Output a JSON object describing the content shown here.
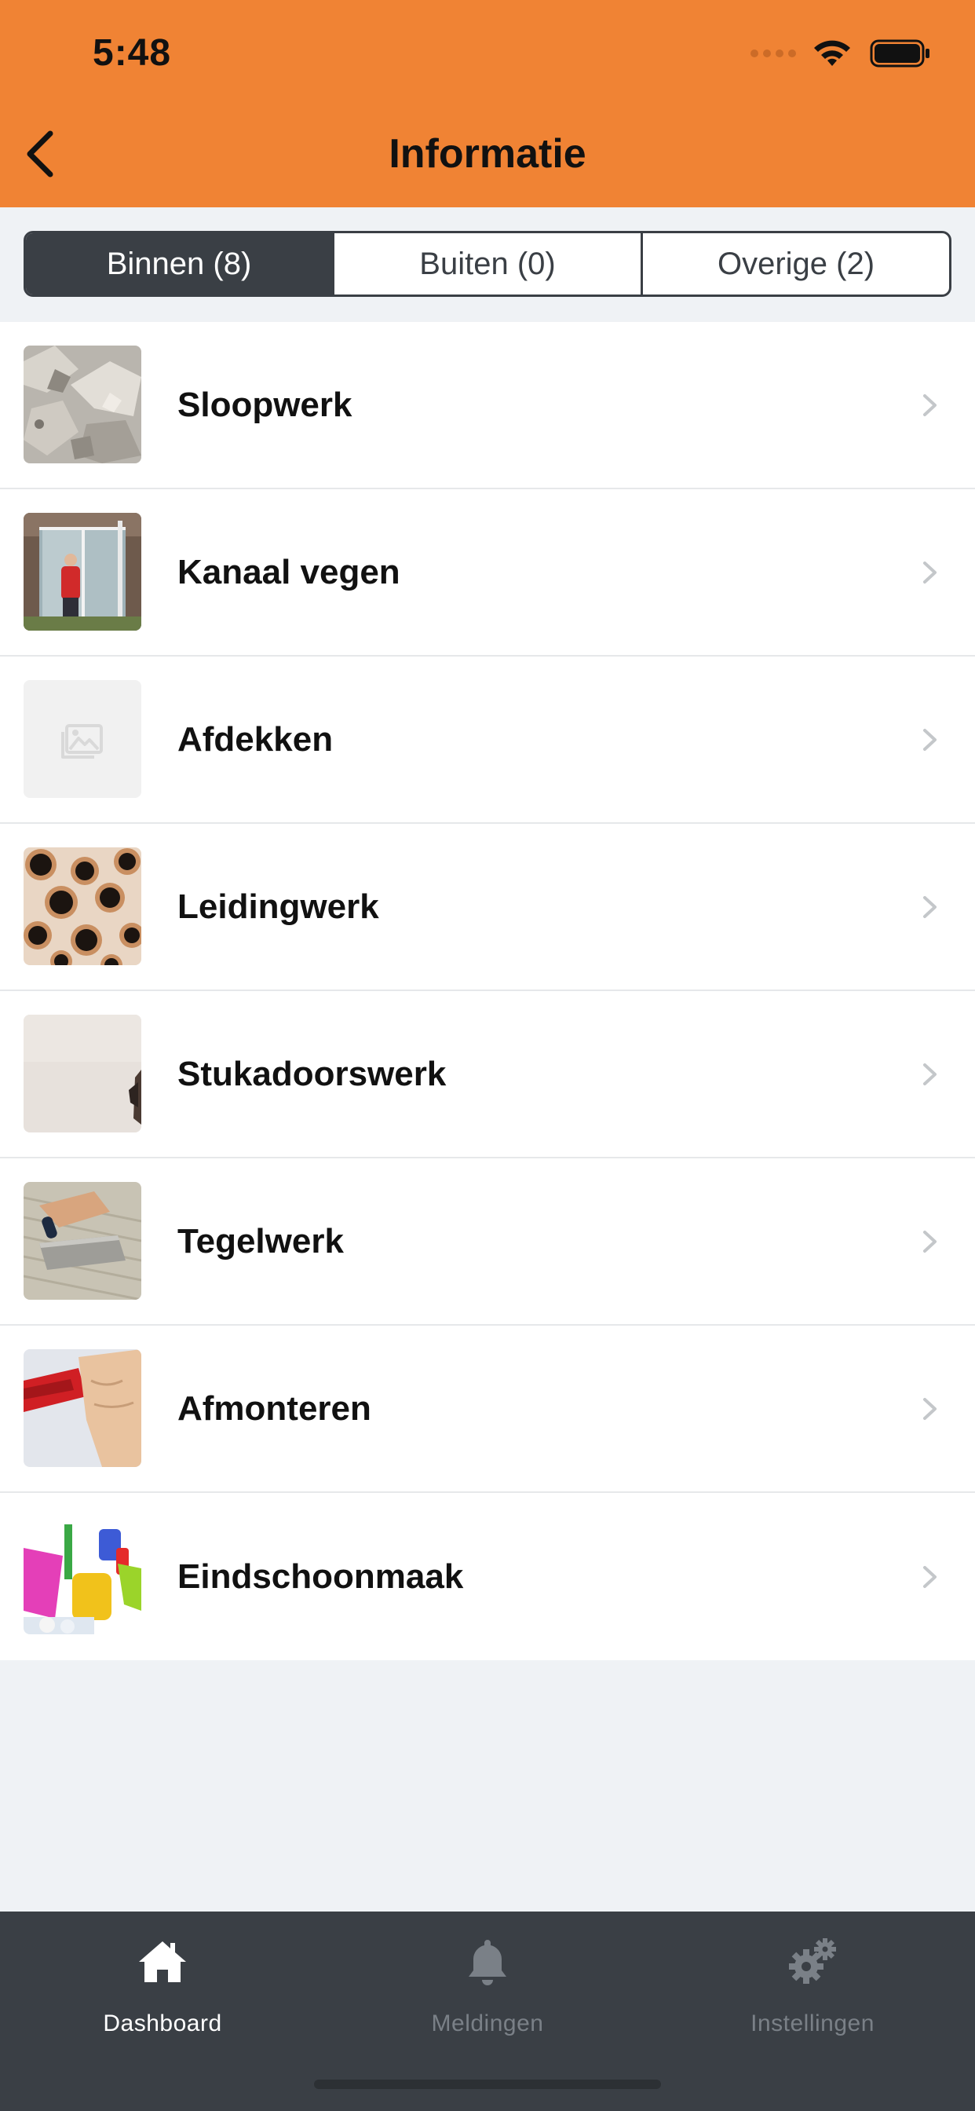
{
  "status_bar": {
    "time": "5:48"
  },
  "header": {
    "title": "Informatie",
    "bg_color": "#f08334"
  },
  "segments": [
    {
      "label": "Binnen (8)",
      "active": true
    },
    {
      "label": "Buiten (0)",
      "active": false
    },
    {
      "label": "Overige (2)",
      "active": false
    }
  ],
  "items": [
    {
      "label": "Sloopwerk",
      "thumb": "rubble-image"
    },
    {
      "label": "Kanaal vegen",
      "thumb": "window-worker-image"
    },
    {
      "label": "Afdekken",
      "thumb": "placeholder-image-icon"
    },
    {
      "label": "Leidingwerk",
      "thumb": "copper-pipes-image"
    },
    {
      "label": "Stukadoorswerk",
      "thumb": "plaster-wall-image"
    },
    {
      "label": "Tegelwerk",
      "thumb": "tile-trowel-image"
    },
    {
      "label": "Afmonteren",
      "thumb": "hand-tape-image"
    },
    {
      "label": "Eindschoonmaak",
      "thumb": "cleaning-supplies-image"
    }
  ],
  "tabbar": {
    "tabs": [
      {
        "label": "Dashboard",
        "icon": "home-icon",
        "active": true
      },
      {
        "label": "Meldingen",
        "icon": "bell-icon",
        "active": false
      },
      {
        "label": "Instellingen",
        "icon": "gears-icon",
        "active": false
      }
    ]
  }
}
